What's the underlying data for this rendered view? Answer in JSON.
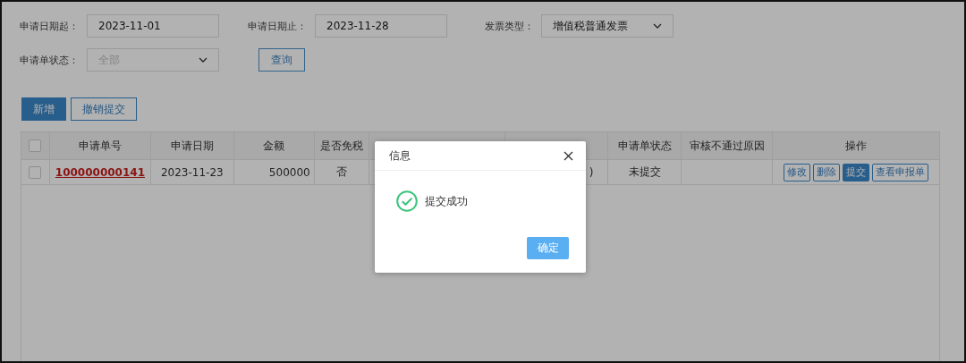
{
  "filters": [
    {
      "label": "申请日期起：",
      "kind": "date",
      "value": "2023-11-01"
    },
    {
      "label": "申请日期止：",
      "kind": "date",
      "value": "2023-11-28"
    },
    {
      "label": "发票类型：",
      "kind": "select",
      "value": "增值税普通发票"
    },
    {
      "label": "申请单状态：",
      "kind": "select",
      "placeholder": "全部"
    }
  ],
  "query_button": "查询",
  "toolbar": [
    {
      "label": "新增",
      "kind": "primary"
    },
    {
      "label": "撤销提交",
      "kind": "default"
    }
  ],
  "table": {
    "header_checked": false,
    "columns": [
      "申请单号",
      "申请日期",
      "金额",
      "是否免税",
      null,
      null,
      "申请单状态",
      "审核不通过原因",
      "操作"
    ],
    "rows": [
      {
        "checked": false,
        "cells": [
          "100000000141",
          "2023-11-23",
          "500000",
          "否",
          null,
          ")",
          "未提交",
          null
        ],
        "actions": [
          {
            "label": "修改",
            "kind": "default"
          },
          {
            "label": "删除",
            "kind": "default"
          },
          {
            "label": "提交",
            "kind": "primary"
          },
          {
            "label": "查看申报单",
            "kind": "default"
          }
        ]
      }
    ]
  },
  "dialog": {
    "title": "信息",
    "message": "提交成功",
    "confirm": "确定"
  }
}
